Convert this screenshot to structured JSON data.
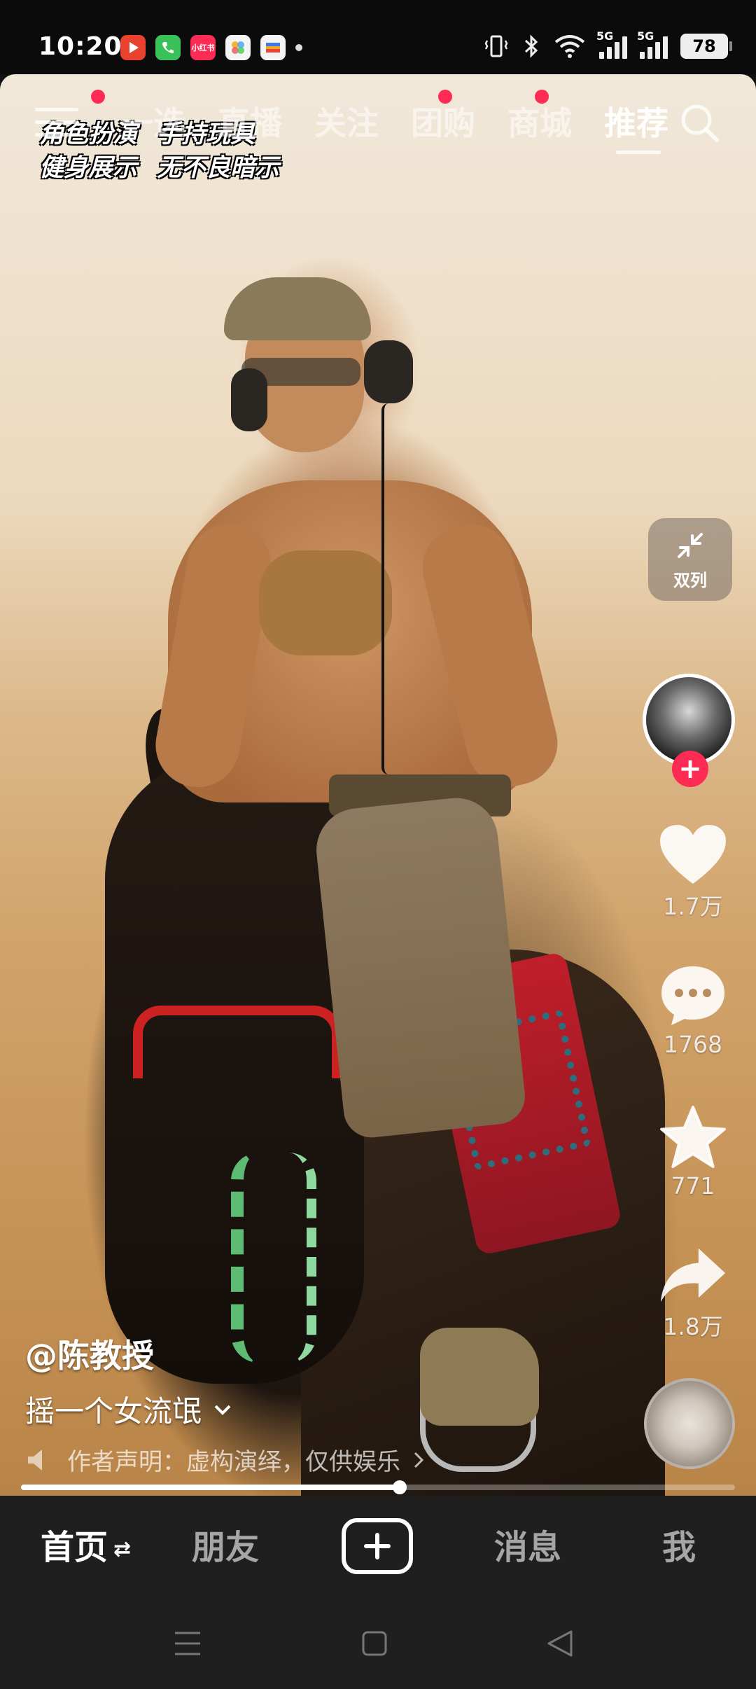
{
  "status_bar": {
    "time": "10:20",
    "apps": [
      {
        "icon": "video-app-icon",
        "color": "#e9432f",
        "text": ""
      },
      {
        "icon": "phone-app-icon",
        "color": "#3bc15a",
        "text": ""
      },
      {
        "icon": "xiaohongshu-app-icon",
        "color": "#fe2c55",
        "text": "小红书"
      },
      {
        "icon": "photos-app-icon",
        "color": "#f4f4f4",
        "text": ""
      },
      {
        "icon": "wallet-app-icon",
        "color": "#f4f4f4",
        "text": ""
      }
    ],
    "network_1": "5G",
    "network_2": "5G",
    "battery": "78"
  },
  "top_nav": {
    "tabs": [
      "一选",
      "直播",
      "关注",
      "团购",
      "商城",
      "推荐"
    ],
    "active_tab": "推荐"
  },
  "video": {
    "tags_line1": [
      "角色扮演",
      "手持玩具"
    ],
    "tags_line2": [
      "健身展示",
      "无不良暗示"
    ],
    "progress": 0.53
  },
  "right_rail": {
    "dual_column_label": "双列",
    "likes": "1.7万",
    "comments": "1768",
    "favorites": "771",
    "shares": "1.8万"
  },
  "info": {
    "author": "@陈教授",
    "description": "摇一个女流氓",
    "declaration": "作者声明：虚构演绎，仅供娱乐"
  },
  "bottom_nav": {
    "home": "首页",
    "friends": "朋友",
    "messages": "消息",
    "me": "我"
  },
  "colors": {
    "accent": "#fe2c55",
    "nav_background": "#1f1f1f"
  }
}
